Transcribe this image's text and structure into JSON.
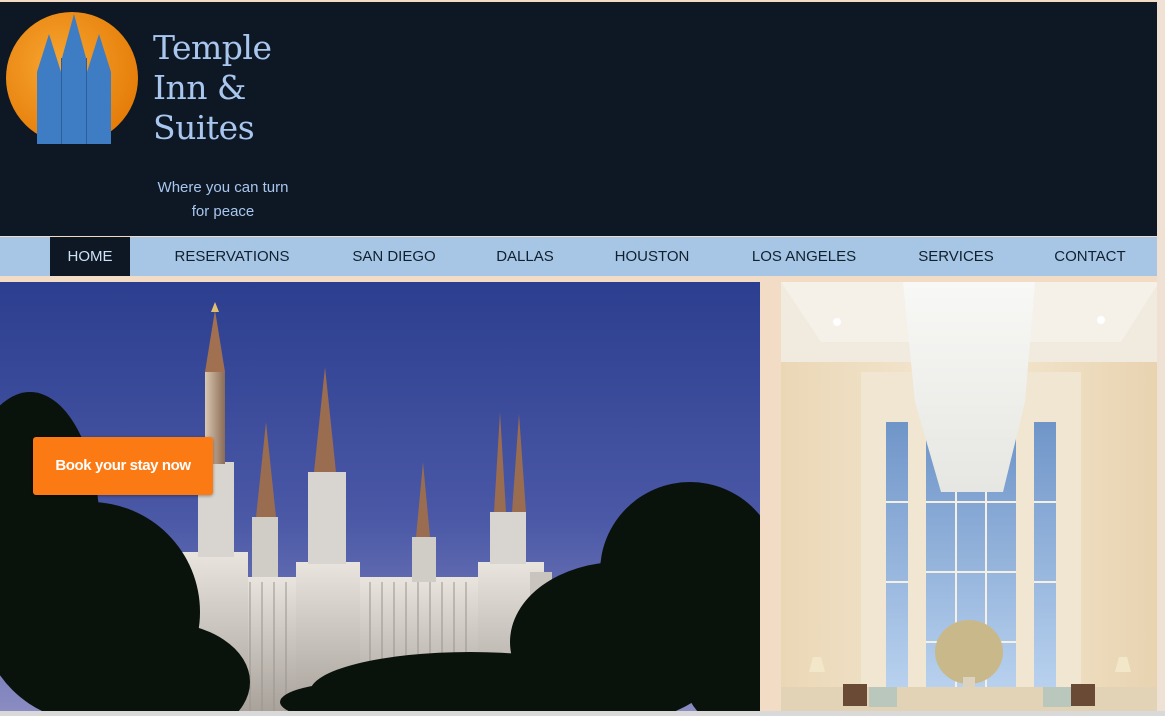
{
  "header": {
    "brand_line1": "Temple",
    "brand_line2": "Inn &",
    "brand_line3": "Suites",
    "tagline_line1": "Where you can turn",
    "tagline_line2": "for peace",
    "logo_icon": "temple-spires-logo-icon"
  },
  "nav": {
    "items": [
      {
        "label": "HOME",
        "active": true
      },
      {
        "label": "RESERVATIONS"
      },
      {
        "label": "SAN DIEGO"
      },
      {
        "label": "DALLAS"
      },
      {
        "label": "HOUSTON"
      },
      {
        "label": "LOS ANGELES"
      },
      {
        "label": "SERVICES"
      },
      {
        "label": "CONTACT"
      }
    ]
  },
  "hero": {
    "cta_label": "Book your stay now"
  },
  "colors": {
    "header_bg": "#0d1824",
    "nav_bg": "#a7c6e6",
    "brand_text": "#a9c6ee",
    "cta_bg": "#fb7a14",
    "logo_sun": "#f08a12",
    "logo_spires": "#3e7cc4"
  }
}
